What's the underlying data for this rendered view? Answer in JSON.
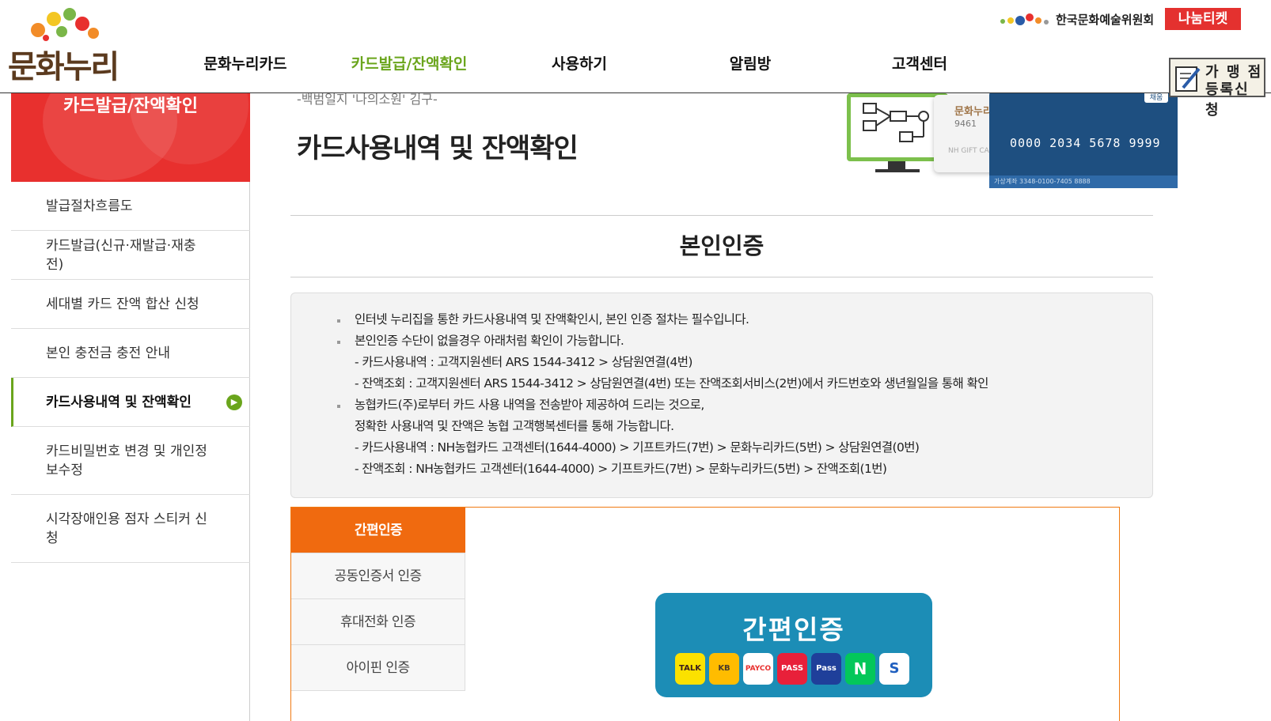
{
  "header": {
    "logo": "문화누리",
    "nav": [
      "문화누리카드",
      "카드발급/잔액확인",
      "사용하기",
      "알림방",
      "고객센터"
    ],
    "active_nav": "카드발급/잔액확인",
    "org_name": "한국문화예술위원회",
    "nanum_ticket": "나눔티켓",
    "store_button": [
      "가 맹 점",
      "등록신청"
    ]
  },
  "sidebar": {
    "title": "카드발급/잔액확인",
    "items": [
      {
        "label": "발급절차흐름도"
      },
      {
        "label": "카드발급(신규·재발급·재충전)"
      },
      {
        "label": "세대별 카드 잔액 합산 신청"
      },
      {
        "label": "본인 충전금 충전 안내"
      },
      {
        "label": "카드사용내역 및 잔액확인",
        "active": true
      },
      {
        "label": "카드비밀번호 변경 및 개인정보수정"
      },
      {
        "label": "시각장애인용 점자 스티커 신청"
      }
    ]
  },
  "main": {
    "quote": "-백범일지 '나의소원' 김구-",
    "page_title": "카드사용내역 및 잔액확인",
    "hero": {
      "white_card_title": "문화누리",
      "white_card_number": "9461",
      "white_card_gift": "NH GIFT CARD",
      "card_number": "0000 2034 5678 9999",
      "card_chip": "채움",
      "card_footer": "가상계좌 3348-0100-7405 8888"
    },
    "section_title": "본인인증",
    "notice": [
      {
        "text": "인터넷 누리집을 통한 카드사용내역 및 잔액확인시, 본인 인증 절차는 필수입니다.",
        "bullet": true
      },
      {
        "text": "본인인증 수단이 없을경우 아래처럼 확인이 가능합니다.",
        "bullet": true
      },
      {
        "text": "- 카드사용내역 : 고객지원센터 ARS 1544-3412 > 상담원연결(4번)",
        "bullet": false
      },
      {
        "text": "- 잔액조회 : 고객지원센터 ARS 1544-3412 > 상담원연결(4번) 또는 잔액조회서비스(2번)에서 카드번호와 생년월일을 통해 확인",
        "bullet": false
      },
      {
        "text": "농협카드(주)로부터 카드 사용 내역을 전송받아 제공하여 드리는 것으로,",
        "bullet": true
      },
      {
        "text": "정확한 사용내역 및 잔액은 농협 고객행복센터를 통해 가능합니다.",
        "bullet": false
      },
      {
        "text": "- 카드사용내역 : NH농협카드 고객센터(1644-4000) > 기프트카드(7번) > 문화누리카드(5번) > 상담원연결(0번)",
        "bullet": false
      },
      {
        "text": "- 잔액조회 : NH농협카드 고객센터(1644-4000) > 기프트카드(7번) > 문화누리카드(5번) > 잔액조회(1번)",
        "bullet": false
      }
    ],
    "auth_tabs": [
      {
        "label": "간편인증",
        "active": true
      },
      {
        "label": "공동인증서 인증"
      },
      {
        "label": "휴대전화 인증"
      },
      {
        "label": "아이핀 인증"
      }
    ],
    "easy_auth": {
      "title": "간편인증",
      "providers": [
        {
          "name": "kakao-talk",
          "label": "TALK",
          "color": "#fbe100"
        },
        {
          "name": "kb",
          "label": "KB",
          "color": "#ffbc00"
        },
        {
          "name": "payco",
          "label": "PAYCO",
          "color": "#ffffff"
        },
        {
          "name": "pass",
          "label": "PASS",
          "color": "#e8203a"
        },
        {
          "name": "samsung-pass",
          "label": "Pass",
          "color": "#1f3f9a"
        },
        {
          "name": "naver",
          "label": "N",
          "color": "#03c75a"
        },
        {
          "name": "shinhan",
          "label": "S",
          "color": "#ffffff"
        }
      ]
    }
  }
}
